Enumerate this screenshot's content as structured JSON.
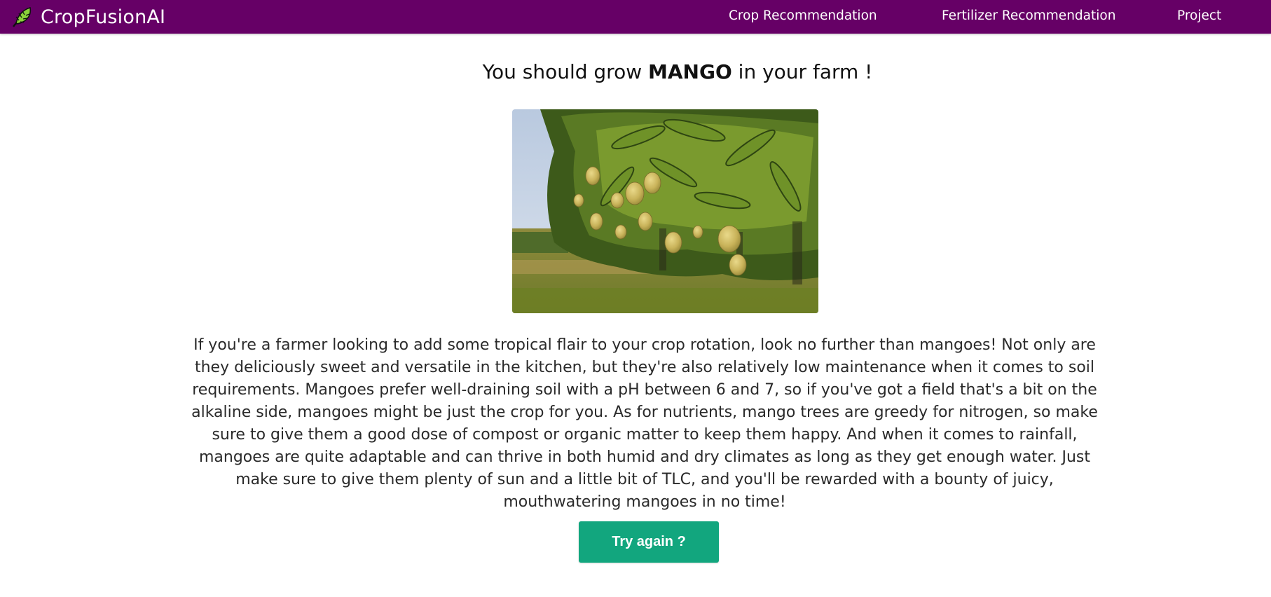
{
  "navbar": {
    "brand": "CropFusionAI",
    "brand_icon": "leaf-icon",
    "links": [
      {
        "label": "Crop Recommendation"
      },
      {
        "label": "Fertilizer Recommendation"
      },
      {
        "label": "Project"
      }
    ],
    "background_color": "#660066"
  },
  "result": {
    "prefix": "You should grow ",
    "crop": "MANGO",
    "suffix": " in your farm !",
    "image_subject": "mango-tree-photo"
  },
  "description": "If you're a farmer looking to add some tropical flair to your crop rotation, look no further than mangoes! Not only are they deliciously sweet and versatile in the kitchen, but they're also relatively low maintenance when it comes to soil requirements. Mangoes prefer well-draining soil with a pH between 6 and 7, so if you've got a field that's a bit on the alkaline side, mangoes might be just the crop for you. As for nutrients, mango trees are greedy for nitrogen, so make sure to give them a good dose of compost or organic matter to keep them happy. And when it comes to rainfall, mangoes are quite adaptable and can thrive in both humid and dry climates as long as they get enough water. Just make sure to give them plenty of sun and a little bit of TLC, and you'll be rewarded with a bounty of juicy, mouthwatering mangoes in no time!",
  "actions": {
    "try_again_label": "Try again ?",
    "button_color": "#12a67e"
  }
}
